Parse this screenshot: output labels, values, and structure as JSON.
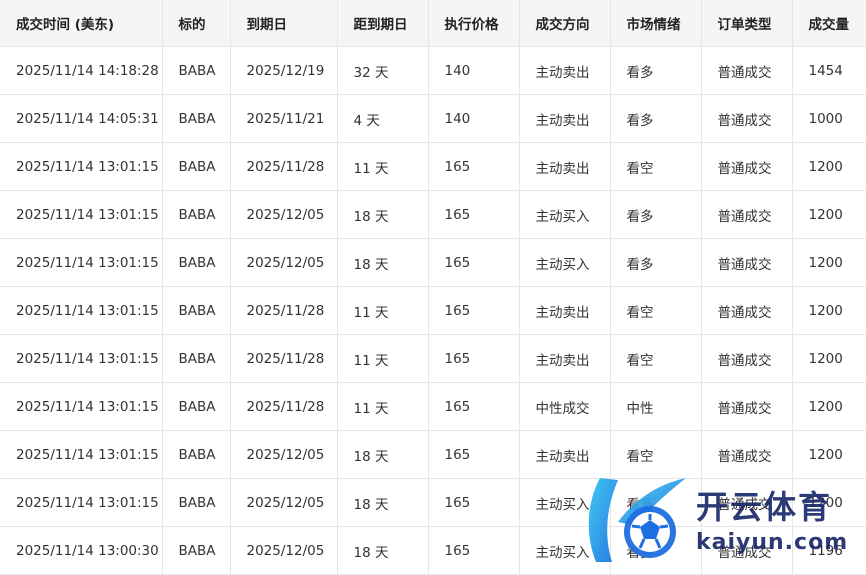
{
  "table": {
    "headers": [
      "成交时间 (美东)",
      "标的",
      "到期日",
      "距到期日",
      "执行价格",
      "成交方向",
      "市场情绪",
      "订单类型",
      "成交量"
    ],
    "rows": [
      [
        "2025/11/14 14:18:28",
        "BABA",
        "2025/12/19",
        "32 天",
        "140",
        "主动卖出",
        "看多",
        "普通成交",
        "1454"
      ],
      [
        "2025/11/14 14:05:31",
        "BABA",
        "2025/11/21",
        "4 天",
        "140",
        "主动卖出",
        "看多",
        "普通成交",
        "1000"
      ],
      [
        "2025/11/14 13:01:15",
        "BABA",
        "2025/11/28",
        "11 天",
        "165",
        "主动卖出",
        "看空",
        "普通成交",
        "1200"
      ],
      [
        "2025/11/14 13:01:15",
        "BABA",
        "2025/12/05",
        "18 天",
        "165",
        "主动买入",
        "看多",
        "普通成交",
        "1200"
      ],
      [
        "2025/11/14 13:01:15",
        "BABA",
        "2025/12/05",
        "18 天",
        "165",
        "主动买入",
        "看多",
        "普通成交",
        "1200"
      ],
      [
        "2025/11/14 13:01:15",
        "BABA",
        "2025/11/28",
        "11 天",
        "165",
        "主动卖出",
        "看空",
        "普通成交",
        "1200"
      ],
      [
        "2025/11/14 13:01:15",
        "BABA",
        "2025/11/28",
        "11 天",
        "165",
        "主动卖出",
        "看空",
        "普通成交",
        "1200"
      ],
      [
        "2025/11/14 13:01:15",
        "BABA",
        "2025/11/28",
        "11 天",
        "165",
        "中性成交",
        "中性",
        "普通成交",
        "1200"
      ],
      [
        "2025/11/14 13:01:15",
        "BABA",
        "2025/12/05",
        "18 天",
        "165",
        "主动卖出",
        "看空",
        "普通成交",
        "1200"
      ],
      [
        "2025/11/14 13:01:15",
        "BABA",
        "2025/12/05",
        "18 天",
        "165",
        "主动买入",
        "看多",
        "普通成交",
        "1200"
      ],
      [
        "2025/11/14 13:00:30",
        "BABA",
        "2025/12/05",
        "18 天",
        "165",
        "主动买入",
        "看多",
        "普通成交",
        "1196"
      ]
    ]
  },
  "watermark": {
    "brand_text": "开云体育",
    "url_text": "kaiyun.com",
    "colors": {
      "blue": "#1e6fe0",
      "cyan": "#35c6f0",
      "navy": "#1a2a6b"
    }
  }
}
